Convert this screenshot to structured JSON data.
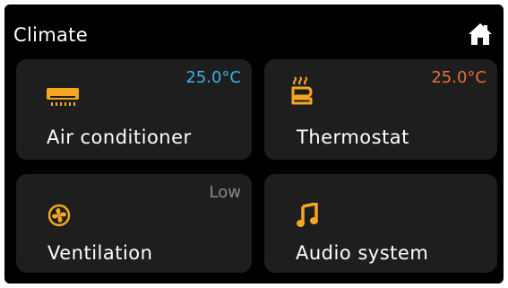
{
  "header": {
    "title": "Climate",
    "home_icon": "home-icon"
  },
  "colors": {
    "accent": "#f5a623",
    "cool": "#3bb3e5",
    "warm": "#e8703a",
    "muted": "#8a8a8a",
    "tile": "#1e1e1e"
  },
  "tiles": [
    {
      "label": "Air conditioner",
      "value": "25.0°C",
      "icon": "air-conditioner-icon"
    },
    {
      "label": "Thermostat",
      "value": "25.0°C",
      "icon": "heater-icon"
    },
    {
      "label": "Ventilation",
      "value": "Low",
      "icon": "fan-icon"
    },
    {
      "label": "Audio system",
      "value": "",
      "icon": "music-note-icon"
    }
  ]
}
